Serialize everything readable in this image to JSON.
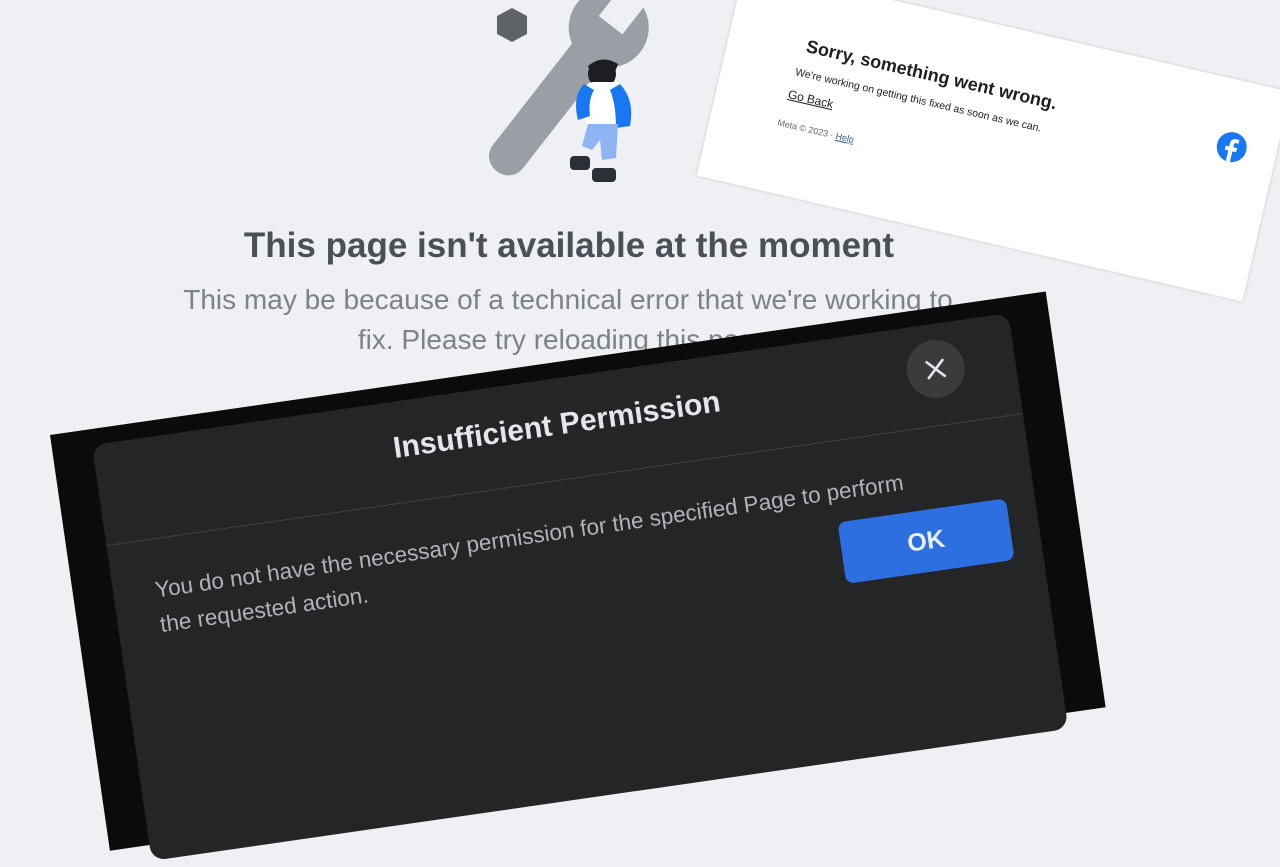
{
  "error_page": {
    "title": "This page isn't available at the moment",
    "description": "This may be because of a technical error that we're working to fix. Please try reloading this page."
  },
  "sorry_card": {
    "title": "Sorry, something went wrong.",
    "description": "We're working on getting this fixed as soon as we can.",
    "go_back_label": "Go Back",
    "footer_text": "Meta © 2023 · ",
    "help_label": "Help",
    "logo_icon": "facebook-logo-icon"
  },
  "dialog": {
    "title": "Insufficient Permission",
    "body": "You do not have the necessary permission for the specified Page to perform the requested action.",
    "ok_label": "OK",
    "close_icon": "close-icon"
  },
  "colors": {
    "page_background": "#eef0f3",
    "dialog_background": "#242526",
    "ok_button": "#2d6ee0",
    "facebook_blue": "#1877f2"
  }
}
